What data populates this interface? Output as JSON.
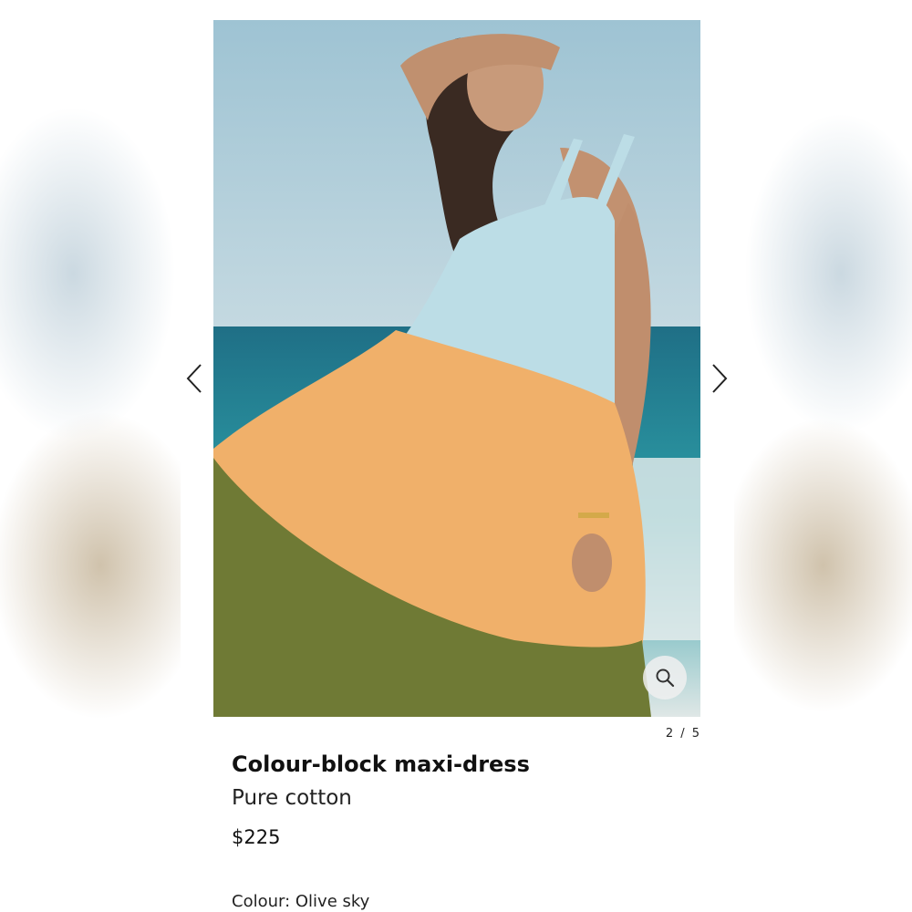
{
  "product": {
    "name": "Colour-block maxi-dress",
    "material": "Pure cotton",
    "price": "$225",
    "colour_label": "Colour: Olive sky"
  },
  "gallery": {
    "counter": "2 / 5",
    "current_index": 2,
    "total": 5
  },
  "icons": {
    "prev": "chevron-left-icon",
    "next": "chevron-right-icon",
    "zoom": "magnifier-icon"
  },
  "colors": {
    "sky": "#a9c7d6",
    "sea": "#2e8a9a",
    "dress_top": "#bcdde6",
    "dress_mid": "#f0b06a",
    "dress_bottom": "#6f7a35"
  }
}
